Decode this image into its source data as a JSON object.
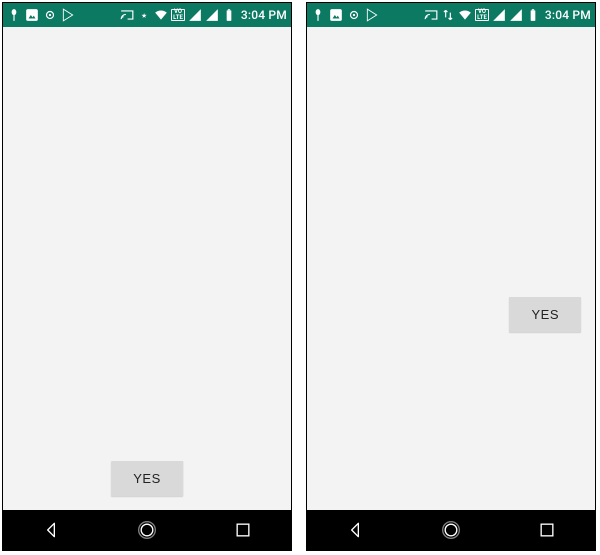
{
  "screens": {
    "left": {
      "statusbar": {
        "time": "3:04 PM",
        "notif_icons": [
          "spoon-icon",
          "mountain-icon",
          "dot-icon",
          "play-icon"
        ],
        "sys_icons": [
          "cast-icon",
          "asterisk-icon",
          "wifi-icon",
          "volte-icon",
          "signal-icon",
          "signal-icon",
          "battery-icon"
        ]
      },
      "button_label": "YES"
    },
    "right": {
      "statusbar": {
        "time": "3:04 PM",
        "notif_icons": [
          "spoon-icon",
          "mountain-icon",
          "dot-icon",
          "play-icon"
        ],
        "sys_icons": [
          "cast-icon",
          "transfer-icon",
          "wifi-icon",
          "volte-icon",
          "signal-icon",
          "signal-icon",
          "battery-icon"
        ]
      },
      "button_label": "YES"
    }
  },
  "labels": {
    "volte_top": "VO",
    "volte_bot": "LTE"
  }
}
